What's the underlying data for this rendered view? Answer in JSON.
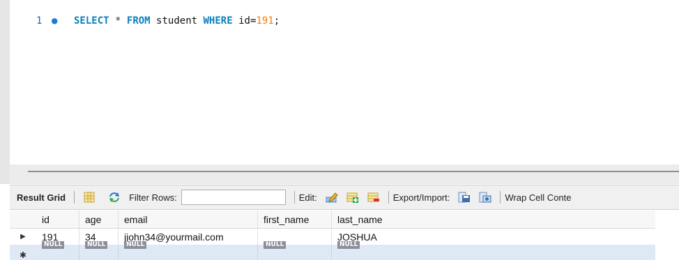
{
  "editor": {
    "line_number": "1",
    "code": {
      "kw_select": "SELECT",
      "star": "*",
      "kw_from": "FROM",
      "table": "student",
      "kw_where": "WHERE",
      "condition": "id=",
      "value": "191",
      "semicolon": ";"
    }
  },
  "toolbar": {
    "result_grid": "Result Grid",
    "filter_rows": "Filter Rows:",
    "filter_value": "",
    "edit": "Edit:",
    "export_import": "Export/Import:",
    "wrap_cell": "Wrap Cell Conte"
  },
  "grid": {
    "columns": [
      "id",
      "age",
      "email",
      "first_name",
      "last_name"
    ],
    "rows": [
      [
        "191",
        "34",
        "jjohn34@yourmail.com",
        "",
        "JOSHUA"
      ]
    ],
    "null_label": "NULL"
  },
  "colors": {
    "keyword": "#0a7fbd",
    "number": "#ff7a00",
    "null_row": "#dfe8f5"
  }
}
